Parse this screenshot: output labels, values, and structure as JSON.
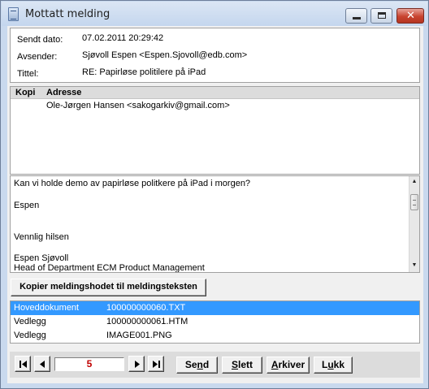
{
  "window": {
    "title": "Mottatt melding"
  },
  "header": {
    "fields": [
      {
        "label": "Sendt dato:",
        "value": "07.02.2011 20:29:42"
      },
      {
        "label": "Avsender:",
        "value": "Sjøvoll Espen <Espen.Sjovoll@edb.com>"
      },
      {
        "label": "Tittel:",
        "value": "RE: Papirløse politilere på iPad"
      }
    ]
  },
  "copies": {
    "columns": [
      "Kopi",
      "Adresse"
    ],
    "rows": [
      {
        "kopi": "",
        "adresse": "Ole-Jørgen Hansen <sakogarkiv@gmail.com>"
      }
    ]
  },
  "body": {
    "lines": [
      "Kan vi holde demo av papirløse politkere på iPad i morgen?",
      "Espen",
      "Vennlig hilsen",
      "Espen Sjøvoll",
      "Head of Department ECM Product Management"
    ]
  },
  "copy_header_button": "Kopier meldingshodet til meldingsteksten",
  "attachments": [
    {
      "type": "Hoveddokument",
      "file": "100000000060.TXT",
      "selected": true
    },
    {
      "type": "Vedlegg",
      "file": "100000000061.HTM",
      "selected": false
    },
    {
      "type": "Vedlegg",
      "file": "IMAGE001.PNG",
      "selected": false
    }
  ],
  "navigation": {
    "page": "5"
  },
  "actions": {
    "send": {
      "pre": "Se",
      "key": "n",
      "post": "d"
    },
    "delete": {
      "pre": "",
      "key": "S",
      "post": "lett"
    },
    "archive": {
      "pre": "",
      "key": "A",
      "post": "rkiver"
    },
    "close": {
      "pre": "L",
      "key": "u",
      "post": "kk"
    }
  },
  "icons": {
    "app": "document-icon",
    "first": "first-record-icon",
    "prev": "previous-record-icon",
    "next": "next-record-icon",
    "last": "last-record-icon"
  },
  "colors": {
    "selection": "#3399ff",
    "page_number": "#c00000",
    "close_button": "#c8432f"
  }
}
